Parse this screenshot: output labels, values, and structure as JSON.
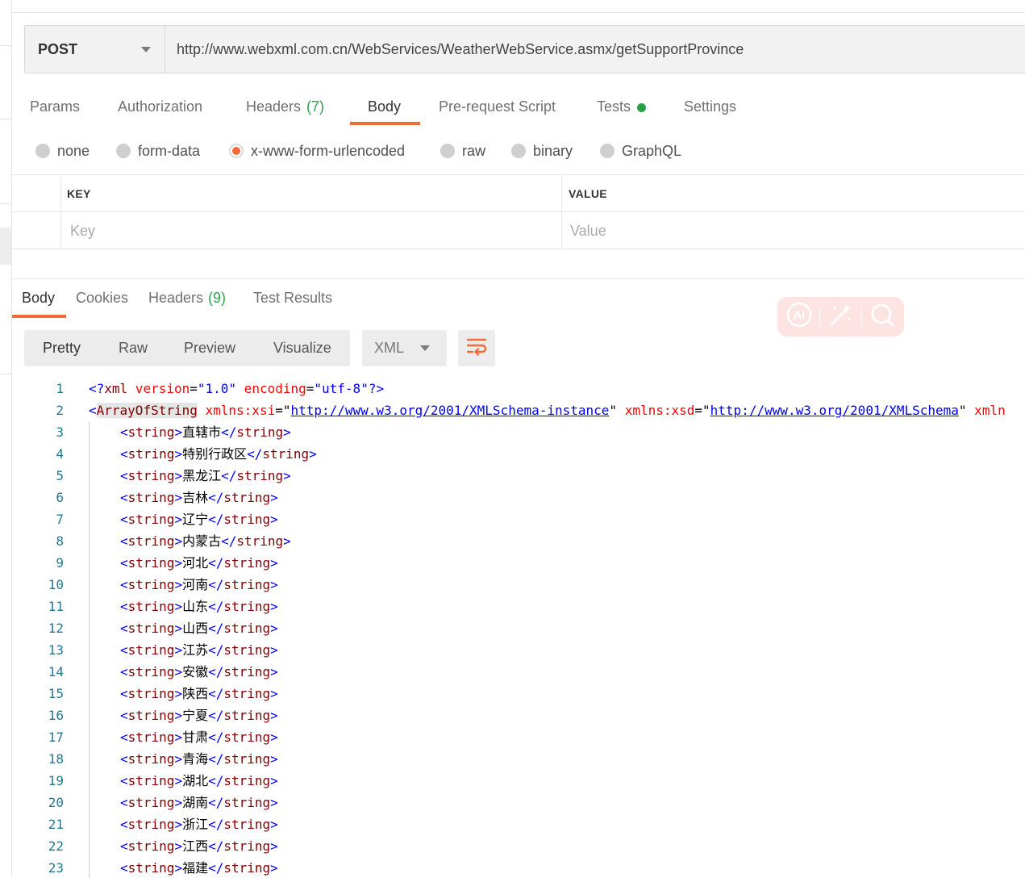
{
  "request": {
    "method": "POST",
    "url": "http://www.webxml.com.cn/WebServices/WeatherWebService.asmx/getSupportProvince"
  },
  "request_tabs": {
    "params": "Params",
    "authorization": "Authorization",
    "headers": "Headers",
    "headers_count": "(7)",
    "body": "Body",
    "prerequest": "Pre-request Script",
    "tests": "Tests",
    "settings": "Settings",
    "active": "Body"
  },
  "body_types": {
    "none": "none",
    "form_data": "form-data",
    "urlencoded": "x-www-form-urlencoded",
    "raw": "raw",
    "binary": "binary",
    "graphql": "GraphQL",
    "selected": "x-www-form-urlencoded"
  },
  "kv_table": {
    "key_header": "KEY",
    "value_header": "VALUE",
    "key_placeholder": "Key",
    "value_placeholder": "Value"
  },
  "response_tabs": {
    "body": "Body",
    "cookies": "Cookies",
    "headers": "Headers",
    "headers_count": "(9)",
    "test_results": "Test Results",
    "active": "Body"
  },
  "view_modes": {
    "pretty": "Pretty",
    "raw": "Raw",
    "preview": "Preview",
    "visualize": "Visualize",
    "active": "Pretty"
  },
  "format": "XML",
  "code": {
    "line1": {
      "num": "1",
      "open": "<?",
      "tag": "xml",
      "a1": " version",
      "eq1": "=",
      "v1": "\"1.0\"",
      "a2": " encoding",
      "eq2": "=",
      "v2": "\"utf-8\"",
      "close": "?>"
    },
    "line2": {
      "num": "2",
      "lt": "<",
      "tag": "ArrayOfString",
      "a1": " xmlns:xsi",
      "eq1": "=\"",
      "link1": "http://www.w3.org/2001/XMLSchema-instance",
      "q1": "\"",
      "a2": " xmlns:xsd",
      "eq2": "=\"",
      "link2": "http://www.w3.org/2001/XMLSchema",
      "q2": "\"",
      "a3": " xmln"
    },
    "string_tag": "string",
    "items": [
      {
        "num": "3",
        "text": "直辖市"
      },
      {
        "num": "4",
        "text": "特别行政区"
      },
      {
        "num": "5",
        "text": "黑龙江"
      },
      {
        "num": "6",
        "text": "吉林"
      },
      {
        "num": "7",
        "text": "辽宁"
      },
      {
        "num": "8",
        "text": "内蒙古"
      },
      {
        "num": "9",
        "text": "河北"
      },
      {
        "num": "10",
        "text": "河南"
      },
      {
        "num": "11",
        "text": "山东"
      },
      {
        "num": "12",
        "text": "山西"
      },
      {
        "num": "13",
        "text": "江苏"
      },
      {
        "num": "14",
        "text": "安徽"
      },
      {
        "num": "15",
        "text": "陕西"
      },
      {
        "num": "16",
        "text": "宁夏"
      },
      {
        "num": "17",
        "text": "甘肃"
      },
      {
        "num": "18",
        "text": "青海"
      },
      {
        "num": "19",
        "text": "湖北"
      },
      {
        "num": "20",
        "text": "湖南"
      },
      {
        "num": "21",
        "text": "浙江"
      },
      {
        "num": "22",
        "text": "江西"
      },
      {
        "num": "23",
        "text": "福建"
      }
    ]
  },
  "colors": {
    "accent": "#f26b3a",
    "count_green": "#2aa54a",
    "tests_dot": "#26a244",
    "xml_tag": "#800000",
    "xml_attr": "#ff0000",
    "xml_value": "#0000ff",
    "line_number": "#237893"
  },
  "icons": {
    "method_dropdown": "chevron-down-icon",
    "format_dropdown": "chevron-down-icon",
    "wrap": "text-wrap-icon",
    "ai": "ai-icon",
    "magic": "magic-wand-icon",
    "search": "search-icon"
  }
}
